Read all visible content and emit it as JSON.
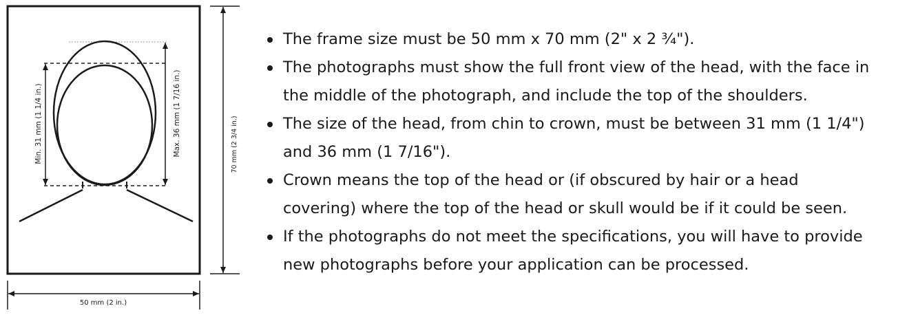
{
  "diagram": {
    "width_label": "50 mm (2 in.)",
    "height_label": "70 mm (2 3/4 in.)",
    "min_head_label": "Min. 31 mm (1 1/4 in.)",
    "max_head_label": "Max. 36 mm (1 7/16 in.)"
  },
  "requirements": [
    [
      "The frame size must be 50 mm x 70 mm (2\" x 2 ¾\")."
    ],
    [
      "The photographs must show the full front view of the head, with the face in",
      "the middle of the photograph, and include the top of the shoulders."
    ],
    [
      "The size of the head, from chin to crown, must be between 31 mm (1 1/4\")",
      "and 36 mm (1 7/16\")."
    ],
    [
      "Crown means the top of the head or (if obscured by hair or a head",
      "covering) where the top of the head or skull would be if it could be seen."
    ],
    [
      "If the photographs do not meet the specifications, you will have to provide",
      "new photographs before your application can be processed."
    ]
  ]
}
